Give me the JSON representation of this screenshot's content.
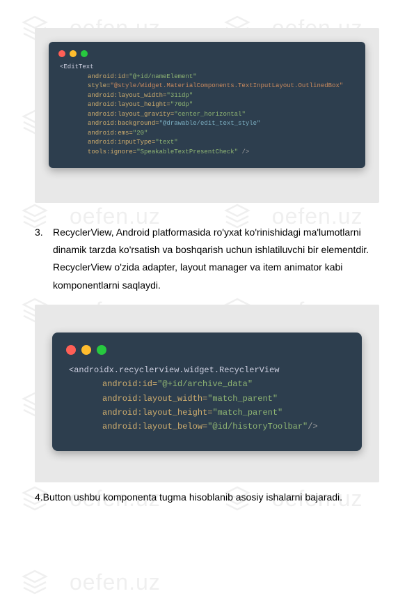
{
  "watermark": {
    "text": "oefen.uz"
  },
  "code1": {
    "tag_open": "<EditText",
    "lines": [
      {
        "attr": "android:id=",
        "val": "\"@+id/nameElement\"",
        "cls": "val-green"
      },
      {
        "attr": "style=",
        "val": "\"@style/Widget.MaterialComponents.TextInputLayout.OutlinedBox\"",
        "cls": "val-orange"
      },
      {
        "attr": "android:layout_width=",
        "val": "\"311dp\"",
        "cls": "val-green"
      },
      {
        "attr": "android:layout_height=",
        "val": "\"70dp\"",
        "cls": "val-green"
      },
      {
        "attr": "android:layout_gravity=",
        "val": "\"center_horizontal\"",
        "cls": "val-green"
      },
      {
        "attr": "android:background=",
        "val": "\"@drawable/edit_text_style\"",
        "cls": "val-blue"
      },
      {
        "attr": "android:ems=",
        "val": "\"20\"",
        "cls": "val-green"
      },
      {
        "attr": "android:inputType=",
        "val": "\"text\"",
        "cls": "val-green"
      },
      {
        "attr": "tools:ignore=",
        "val": "\"SpeakableTextPresentCheck\"",
        "cls": "val-green",
        "close": " />"
      }
    ]
  },
  "paragraph1": {
    "number": "3.",
    "line1": "RecyclerView, Android platformasida ro'yxat ko'rinishidagi ma'lumotlarni",
    "line2": "dinamik tarzda ko'rsatish va boshqarish uchun ishlatiluvchi bir elementdir.",
    "line3": "RecyclerView o'zida adapter, layout manager va item animator kabi",
    "line4": "komponentlarni saqlaydi."
  },
  "code2": {
    "tag_open": "<androidx.recyclerview.widget.RecyclerView",
    "lines": [
      {
        "attr": "android:id=",
        "val": "\"@+id/archive_data\"",
        "cls": "val-green"
      },
      {
        "attr": "android:layout_width=",
        "val": "\"match_parent\"",
        "cls": "val-green"
      },
      {
        "attr": "android:layout_height=",
        "val": "\"match_parent\"",
        "cls": "val-green"
      },
      {
        "attr": "android:layout_below=",
        "val": "\"@id/historyToolbar\"",
        "cls": "val-green",
        "close": "/>"
      }
    ]
  },
  "paragraph2": "4.Button ushbu komponenta tugma hisoblanib asosiy ishalarni bajaradi."
}
